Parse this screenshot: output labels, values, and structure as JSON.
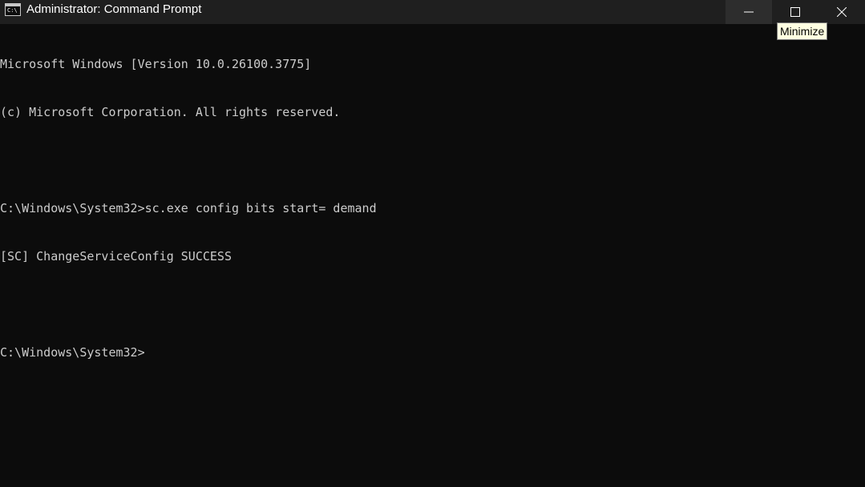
{
  "window": {
    "title": "Administrator: Command Prompt",
    "icon": "cmd-icon",
    "icon_glyph": "C:\\"
  },
  "caption_buttons": [
    {
      "name": "minimize-button",
      "icon": "minimize-icon"
    },
    {
      "name": "maximize-button",
      "icon": "maximize-icon"
    },
    {
      "name": "close-button",
      "icon": "close-icon"
    }
  ],
  "tooltip": {
    "text": "Minimize"
  },
  "console": {
    "lines": [
      "Microsoft Windows [Version 10.0.26100.3775]",
      "(c) Microsoft Corporation. All rights reserved.",
      "",
      "C:\\Windows\\System32>sc.exe config bits start= demand",
      "[SC] ChangeServiceConfig SUCCESS",
      "",
      "C:\\Windows\\System32>"
    ]
  },
  "colors": {
    "console_background": "#0c0c0c",
    "console_text": "#cccccc",
    "titlebar": "#1f1f1f",
    "tooltip_background": "#ffffe1"
  }
}
